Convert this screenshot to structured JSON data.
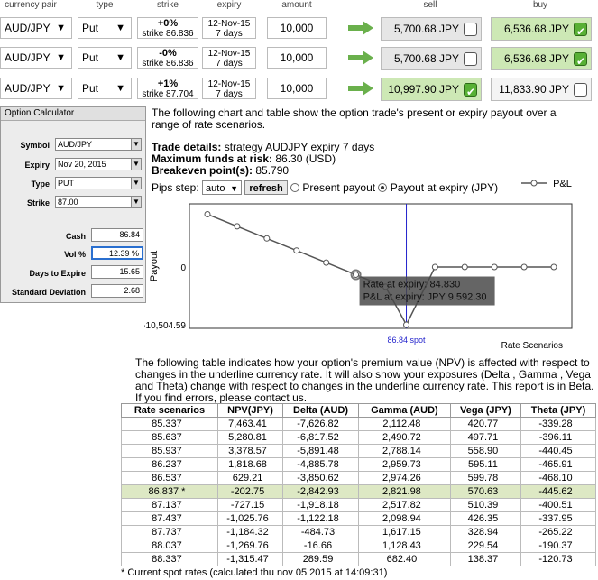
{
  "grid": {
    "headers": {
      "currency_pair": "currency pair",
      "type": "type",
      "strike": "strike",
      "expiry": "expiry",
      "amount": "amount",
      "sell": "sell",
      "buy": "buy"
    },
    "rows": [
      {
        "pair": "AUD/JPY",
        "type": "Put",
        "strike_pct": "+0%",
        "strike": "strike 86.836",
        "expiry_date": "12-Nov-15",
        "expiry_days": "7 days",
        "amount": "10,000",
        "sell": "5,700.68 JPY",
        "buy": "6,536.68 JPY",
        "sell_checked": false,
        "buy_checked": true
      },
      {
        "pair": "AUD/JPY",
        "type": "Put",
        "strike_pct": "-0%",
        "strike": "strike 86.836",
        "expiry_date": "12-Nov-15",
        "expiry_days": "7 days",
        "amount": "10,000",
        "sell": "5,700.68 JPY",
        "buy": "6,536.68 JPY",
        "sell_checked": false,
        "buy_checked": true
      },
      {
        "pair": "AUD/JPY",
        "type": "Put",
        "strike_pct": "+1%",
        "strike": "strike 87.704",
        "expiry_date": "12-Nov-15",
        "expiry_days": "7 days",
        "amount": "10,000",
        "sell": "10,997.90 JPY",
        "buy": "11,833.90 JPY",
        "sell_checked": true,
        "buy_checked": false
      }
    ]
  },
  "calculator": {
    "title": "Option Calculator",
    "symbol_label": "Symbol",
    "symbol": "AUD/JPY",
    "expiry_label": "Expiry",
    "expiry": "Nov 20, 2015",
    "type_label": "Type",
    "type": "PUT",
    "strike_label": "Strike",
    "strike": "87.00",
    "cash_label": "Cash",
    "cash": "86.84",
    "vol_label": "Vol %",
    "vol": "12.39 %",
    "days_label": "Days to Expire",
    "days": "15.65",
    "sd_label": "Standard Deviation",
    "sd": "2.68"
  },
  "intro": "The following chart and table show the option trade's present or expiry payout over a range of rate scenarios.",
  "trade_details": {
    "details_label": "Trade details:",
    "details_value": "strategy AUDJPY expiry 7 days",
    "max_label": "Maximum funds at risk:",
    "max_value": "86.30 (USD)",
    "breakeven_label": "Breakeven point(s):",
    "breakeven_value": "85.790"
  },
  "controls": {
    "pips_label": "Pips step:",
    "pips_value": "auto",
    "refresh": "refresh",
    "present": "Present payout",
    "expiry": "Payout at expiry (JPY)"
  },
  "legend": "P&L",
  "chart_data": {
    "type": "line",
    "ylabel": "Payout",
    "xlabel": "Rate Scenarios",
    "y_tick_labels": [
      "0",
      "-10,504.59"
    ],
    "spot_label": "86.84 spot",
    "tooltip": [
      "Rate at expiry: 84.830",
      "P&L at expiry: JPY 9,592.30"
    ],
    "x": [
      84.83,
      85.13,
      85.43,
      85.73,
      86.03,
      86.33,
      86.63,
      86.84,
      87.13,
      87.43,
      87.73,
      88.03,
      88.33
    ],
    "series": [
      {
        "name": "P&L",
        "values": [
          9592.3,
          7400,
          5200,
          3000,
          800,
          -1400,
          -3600,
          -10504.59,
          0,
          0,
          0,
          0,
          0
        ]
      }
    ],
    "ylim": [
      -10504.59,
      10500
    ]
  },
  "table_intro": "The following table indicates how your option's premium value (NPV) is affected with respect to changes in the underline currency rate. It will also show your exposures (Delta , Gamma , Vega and Theta) change with respect to changes in the underline currency rate. This report is in Beta. If you find errors, please contact us.",
  "table": {
    "headers": [
      "Rate scenarios",
      "NPV(JPY)",
      "Delta (AUD)",
      "Gamma (AUD)",
      "Vega (JPY)",
      "Theta (JPY)"
    ],
    "rows": [
      [
        "85.337",
        "7,463.41",
        "-7,626.82",
        "2,112.48",
        "420.77",
        "-339.28"
      ],
      [
        "85.637",
        "5,280.81",
        "-6,817.52",
        "2,490.72",
        "497.71",
        "-396.11"
      ],
      [
        "85.937",
        "3,378.57",
        "-5,891.48",
        "2,788.14",
        "558.90",
        "-440.45"
      ],
      [
        "86.237",
        "1,818.68",
        "-4,885.78",
        "2,959.73",
        "595.11",
        "-465.91"
      ],
      [
        "86.537",
        "629.21",
        "-3,850.62",
        "2,974.26",
        "599.78",
        "-468.10"
      ],
      [
        "86.837 *",
        "-202.75",
        "-2,842.93",
        "2,821.98",
        "570.63",
        "-445.62"
      ],
      [
        "87.137",
        "-727.15",
        "-1,918.18",
        "2,517.82",
        "510.39",
        "-400.51"
      ],
      [
        "87.437",
        "-1,025.76",
        "-1,122.18",
        "2,098.94",
        "426.35",
        "-337.95"
      ],
      [
        "87.737",
        "-1,184.32",
        "-484.73",
        "1,617.15",
        "328.94",
        "-265.22"
      ],
      [
        "88.037",
        "-1,269.76",
        "-16.66",
        "1,128.43",
        "229.54",
        "-190.37"
      ],
      [
        "88.337",
        "-1,315.47",
        "289.59",
        "682.40",
        "138.37",
        "-120.73"
      ]
    ],
    "spot_row_index": 5
  },
  "footnote": "* Current spot rates (calculated thu nov 05 2015 at 14:09:31)",
  "colors": {
    "go_arrow": "#6ab04c",
    "buy_bg": "#cde8b5",
    "spot_line": "#2222cc",
    "highlight_row": "#dde8c4"
  }
}
